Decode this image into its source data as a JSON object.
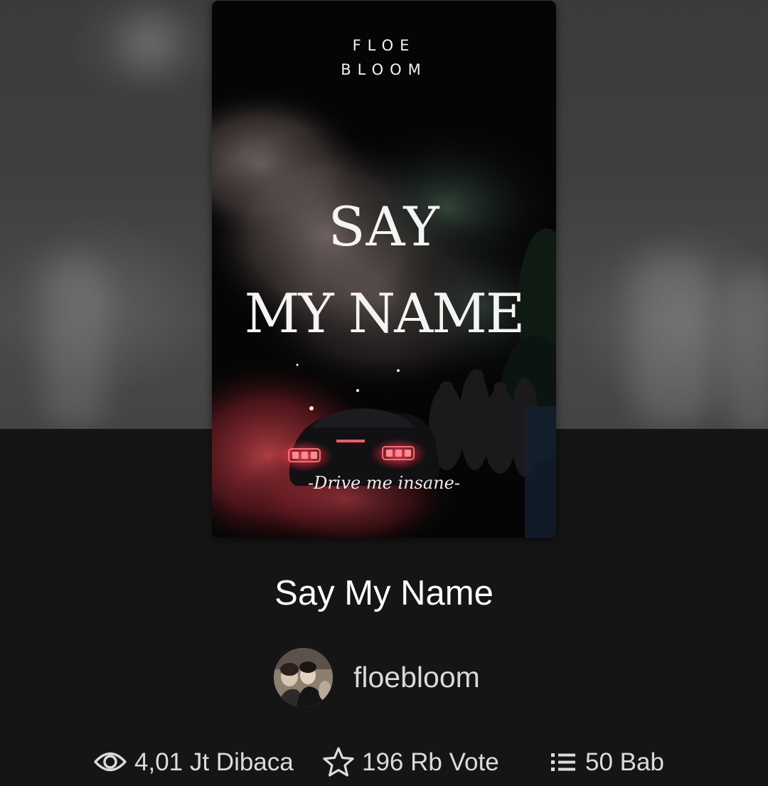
{
  "cover": {
    "author_line1": "FLOE",
    "author_line2": "BLOOM",
    "title_line1": "SAY",
    "title_line2": "MY NAME",
    "tagline": "-Drive me insane-"
  },
  "book": {
    "title": "Say My Name",
    "author": "floebloom"
  },
  "stats": {
    "reads_icon": "eye-icon",
    "reads": "4,01 Jt Dibaca",
    "votes_icon": "star-outline-icon",
    "votes": "196 Rb Vote",
    "parts_icon": "list-icon",
    "parts": "50 Bab"
  },
  "colors": {
    "background": "#151515",
    "text_primary": "#ffffff",
    "text_secondary": "#dcdcdc",
    "taillight_red": "#e0303a"
  }
}
